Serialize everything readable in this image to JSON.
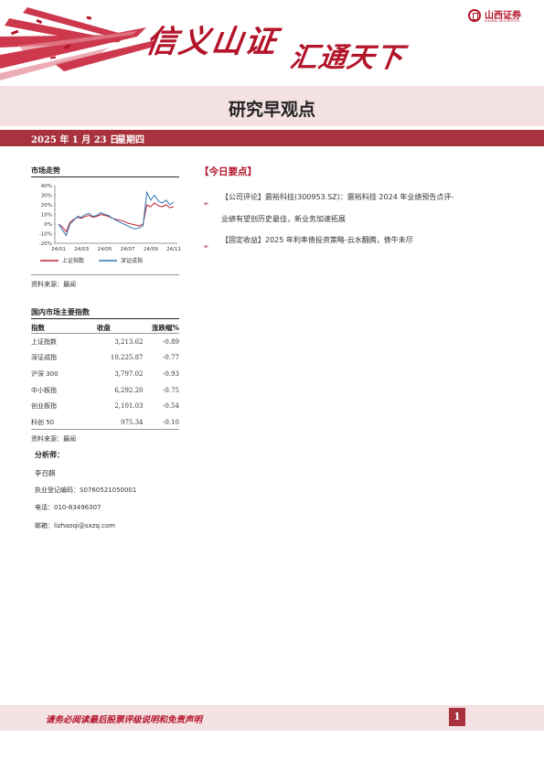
{
  "brand": {
    "slogan_part1": "信义山证",
    "slogan_part2": "汇通天下",
    "logo_text": "山西证券",
    "logo_sub": "SHANXI SECURITIES",
    "brand_color": "#b3142a"
  },
  "report": {
    "title": "研究早观点",
    "date": "2025 年 1 月 23 日",
    "weekday": "星期四"
  },
  "market_trend": {
    "section_title": "市场走势",
    "source": "资料来源：最闻",
    "chart_data": {
      "type": "line",
      "title": "",
      "xlabel": "",
      "ylabel": "",
      "ylim": [
        -20,
        40
      ],
      "y_ticks": [
        "40%",
        "30%",
        "20%",
        "10%",
        "0%",
        "-10%",
        "-20%"
      ],
      "x_ticks": [
        "24/01",
        "24/03",
        "24/05",
        "24/07",
        "24/09",
        "24/11"
      ],
      "legend_position": "bottom",
      "series": [
        {
          "name": "上证指数",
          "color": "#c0202a",
          "values": [
            0,
            -3,
            -8,
            2,
            5,
            7,
            6,
            8,
            9,
            7,
            8,
            10,
            9,
            8,
            6,
            5,
            4,
            3,
            1,
            0,
            -1,
            -2,
            0,
            20,
            18,
            22,
            19,
            18,
            20,
            17,
            18
          ]
        },
        {
          "name": "深证成指",
          "color": "#2e75b6",
          "values": [
            0,
            -6,
            -12,
            0,
            4,
            8,
            7,
            10,
            11,
            8,
            9,
            12,
            10,
            9,
            6,
            4,
            2,
            0,
            -2,
            -4,
            -5,
            -4,
            -2,
            33,
            25,
            30,
            24,
            22,
            25,
            20,
            23
          ]
        }
      ]
    }
  },
  "domestic_indices": {
    "section_title": "国内市场主要指数",
    "headers": [
      "指数",
      "收盘",
      "涨跌幅%"
    ],
    "rows": [
      {
        "name": "上证指数",
        "close": "3,213.62",
        "change": "-0.89"
      },
      {
        "name": "深证成指",
        "close": "10,225.87",
        "change": "-0.77"
      },
      {
        "name": "沪深 300",
        "close": "3,797.02",
        "change": "-0.93"
      },
      {
        "name": "中小板指",
        "close": "6,292.20",
        "change": "-0.75"
      },
      {
        "name": "创业板指",
        "close": "2,101.03",
        "change": "-0.54"
      },
      {
        "name": "科创 50",
        "close": "975.34",
        "change": "-0.10"
      }
    ],
    "source": "资料来源：最闻"
  },
  "analyst": {
    "label": "分析师：",
    "name": "李召麒",
    "license": "执业登记编码：S0760521050001",
    "phone": "电话：010-83496307",
    "email": "邮箱：lizhaoqi@sxzq.com"
  },
  "today_points": {
    "heading": "【今日要点】",
    "items": [
      {
        "tag": "【公司评论】",
        "line1": "震裕科技(300953.SZ)：震裕科技 2024 年业绩预告点评-",
        "line2": "业绩有望创历史最佳，新业务加速拓展"
      },
      {
        "tag": "【固定收益】",
        "line1": "2025 年利率债投资策略-云水翻腾，债牛未尽"
      }
    ]
  },
  "footer": {
    "disclaimer": "请务必阅读最后股票评级说明和免责声明",
    "page": "1"
  }
}
